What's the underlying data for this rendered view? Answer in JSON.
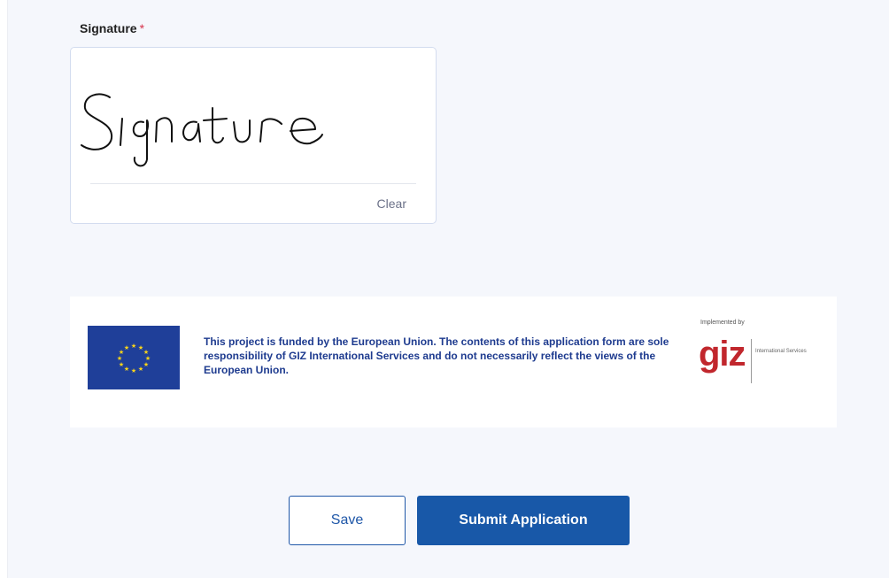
{
  "signature": {
    "label": "Signature",
    "required_marker": "*",
    "drawn_value": "Signature",
    "clear_label": "Clear"
  },
  "funding_banner": {
    "flag_icon": "eu-flag-icon",
    "text": "This project is funded by the European Union. The contents of this application form are sole responsibility of GIZ International Services and do not necessarily reflect the views of the European Union.",
    "implemented_by": "Implemented by",
    "logo_text": "giz",
    "logo_subtext": "International Services"
  },
  "actions": {
    "save_label": "Save",
    "submit_label": "Submit Application"
  },
  "colors": {
    "page_background": "#f5f7fc",
    "primary": "#1858a8",
    "required": "#d6334b",
    "eu_blue": "#1f3f99",
    "eu_star": "#ffd617",
    "giz_red": "#c1272d"
  }
}
